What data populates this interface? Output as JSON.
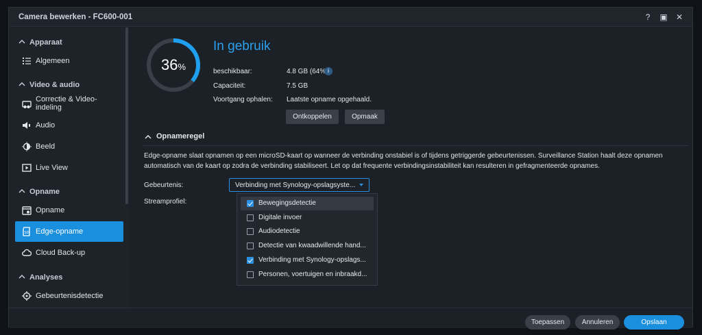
{
  "window": {
    "title": "Camera bewerken - FC600-001",
    "help": "?",
    "maximize": "▣",
    "close": "✕"
  },
  "sidebar": {
    "sections": [
      {
        "label": "Apparaat"
      },
      {
        "label": "Video & audio"
      },
      {
        "label": "Opname"
      },
      {
        "label": "Analyses"
      }
    ],
    "items": [
      {
        "label": "Algemeen",
        "icon": "list-icon"
      },
      {
        "label": "Correctie & Video-indeling",
        "icon": "camera-icon"
      },
      {
        "label": "Audio",
        "icon": "speaker-icon"
      },
      {
        "label": "Beeld",
        "icon": "brightness-icon"
      },
      {
        "label": "Live View",
        "icon": "play-icon"
      },
      {
        "label": "Opname",
        "icon": "calendar-icon"
      },
      {
        "label": "Edge-opname",
        "icon": "sd-card-icon"
      },
      {
        "label": "Cloud Back-up",
        "icon": "cloud-icon"
      },
      {
        "label": "Gebeurtenisdetectie",
        "icon": "target-icon"
      }
    ]
  },
  "storage": {
    "percent": "36",
    "percent_sign": "%",
    "usage_fraction": 0.36,
    "status": "In gebruik",
    "available_label": "beschikbaar:",
    "available_value": "4.8 GB (64%)",
    "capacity_label": "Capaciteit:",
    "capacity_value": "7.5 GB",
    "progress_label": "Voortgang ophalen:",
    "progress_value": "Laatste opname opgehaald.",
    "disconnect_label": "Ontkoppelen",
    "format_label": "Opmaak"
  },
  "rule": {
    "title": "Opnameregel",
    "description": "Edge-opname slaat opnamen op een microSD-kaart op wanneer de verbinding onstabiel is of tijdens getriggerde gebeurtenissen. Surveillance Station haalt deze opnamen automatisch van de kaart op zodra de verbinding stabiliseert. Let op dat frequente verbindingsinstabiliteit kan resulteren in gefragmenteerde opnames.",
    "event_label": "Gebeurtenis:",
    "event_value": "Verbinding met Synology-opslagsyste...",
    "stream_label": "Streamprofiel:",
    "options": [
      {
        "label": "Bewegingsdetectie",
        "checked": true
      },
      {
        "label": "Digitale invoer",
        "checked": false
      },
      {
        "label": "Audiodetectie",
        "checked": false
      },
      {
        "label": "Detectie van kwaadwillende hand...",
        "checked": false
      },
      {
        "label": "Verbinding met Synology-opslags...",
        "checked": true
      },
      {
        "label": "Personen, voertuigen en inbraakd...",
        "checked": false
      }
    ]
  },
  "footer": {
    "apply": "Toepassen",
    "cancel": "Annuleren",
    "save": "Opslaan"
  },
  "colors": {
    "accent": "#1a8fdd",
    "status": "#2aa0ee"
  }
}
